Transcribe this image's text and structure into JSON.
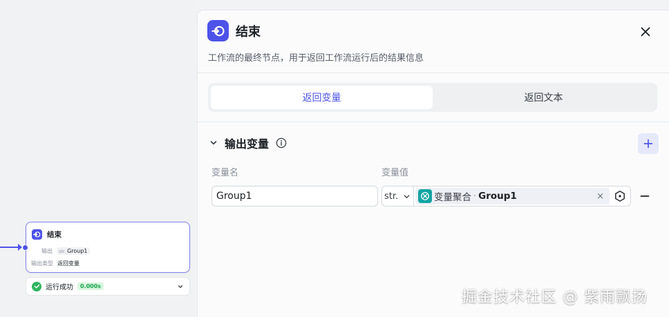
{
  "canvas": {
    "node": {
      "title": "结束",
      "output_label": "输出",
      "output_type_tag": "str.",
      "output_value": "Group1",
      "output_type_label": "输出类型",
      "output_type_value": "返回变量"
    },
    "run": {
      "status": "运行成功",
      "time": "0.000s"
    }
  },
  "panel": {
    "title": "结束",
    "description": "工作流的最终节点，用于返回工作流运行后的结果信息",
    "tabs": [
      {
        "label": "返回变量",
        "active": true
      },
      {
        "label": "返回文本",
        "active": false
      }
    ],
    "section": {
      "title": "输出变量",
      "col_name": "变量名",
      "col_value": "变量值",
      "rows": [
        {
          "name": "Group1",
          "type": "str.",
          "ref_source": "变量聚合",
          "ref_sep": "·",
          "ref_var": "Group1",
          "clear": "×"
        }
      ]
    }
  },
  "watermark": "掘金技术社区 @ 紫雨飘扬",
  "colors": {
    "accent": "#4d53e8",
    "success": "#2fb55e",
    "ref_icon": "#12a4a4"
  }
}
